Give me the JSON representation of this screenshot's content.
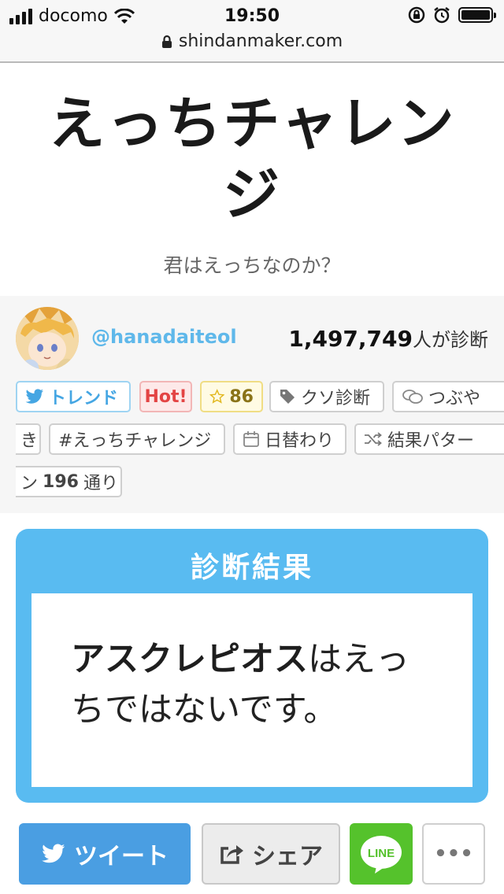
{
  "status_bar": {
    "carrier": "docomo",
    "time": "19:50",
    "url": "shindanmaker.com"
  },
  "page": {
    "title": "えっちチャレンジ",
    "subtitle": "君はえっちなのか？"
  },
  "author": {
    "handle": "@hanadaiteol"
  },
  "stats": {
    "count": "1,497,749",
    "count_suffix": "人が診断"
  },
  "tags": {
    "trend": "トレンド",
    "hot": "Hot!",
    "favorites": "86",
    "category": "クソ診断",
    "tweet_a": "つぶや",
    "tweet_b": "き",
    "hashtag": "#えっちチャレンジ",
    "daily": "日替わり",
    "pattern_prefix": "結果パター",
    "pattern_a": "ン",
    "pattern_count": "196",
    "pattern_suffix": "通り"
  },
  "result": {
    "header": "診断結果",
    "name": "アスクレピオス",
    "text": "はえっちではないです。"
  },
  "share": {
    "tweet": "ツイート",
    "share": "シェア",
    "line": "LINE",
    "more": "•••"
  },
  "colors": {
    "accent": "#59bbf1",
    "twitter": "#4a9ee2",
    "line": "#55c22c",
    "hot": "#e34444"
  }
}
